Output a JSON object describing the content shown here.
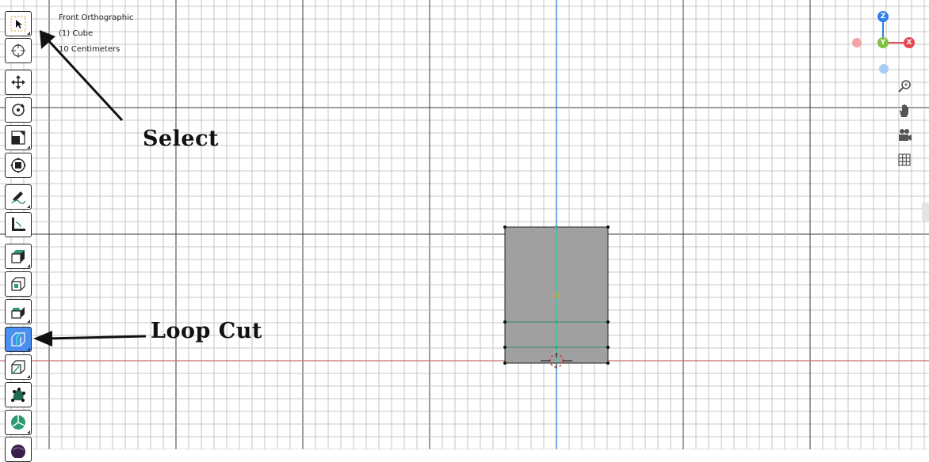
{
  "viewport": {
    "view_name": "Front Orthographic",
    "object_label": "(1) Cube",
    "scale_label": "10 Centimeters"
  },
  "toolbar": {
    "tools": [
      {
        "name": "select-box-tool",
        "icon": "cursor-select-icon",
        "active": false
      },
      {
        "name": "cursor-tool",
        "icon": "crosshair-cursor-icon",
        "active": false
      },
      {
        "name": "move-tool",
        "icon": "move-arrows-icon",
        "active": false
      },
      {
        "name": "rotate-tool",
        "icon": "rotate-icon",
        "active": false
      },
      {
        "name": "scale-tool",
        "icon": "scale-icon",
        "active": false
      },
      {
        "name": "transform-tool",
        "icon": "transform-icon",
        "active": false
      },
      {
        "name": "annotate-tool",
        "icon": "annotate-pencil-icon",
        "active": false
      },
      {
        "name": "measure-tool",
        "icon": "measure-ruler-icon",
        "active": false
      },
      {
        "name": "extrude-tool",
        "icon": "extrude-cube-icon",
        "active": false
      },
      {
        "name": "inset-tool",
        "icon": "inset-faces-icon",
        "active": false
      },
      {
        "name": "bevel-tool",
        "icon": "bevel-icon",
        "active": false
      },
      {
        "name": "loop-cut-tool",
        "icon": "loop-cut-icon",
        "active": true
      },
      {
        "name": "knife-tool",
        "icon": "knife-icon",
        "active": false
      },
      {
        "name": "poly-build-tool",
        "icon": "poly-build-icon",
        "active": false
      },
      {
        "name": "spin-tool",
        "icon": "spin-icon",
        "active": false
      },
      {
        "name": "smooth-tool",
        "icon": "smooth-sphere-icon",
        "active": false
      }
    ]
  },
  "gizmo": {
    "z_label": "Z",
    "y_label": "Y",
    "x_label": "X",
    "colors": {
      "z": "#2f7ee8",
      "y": "#7fc241",
      "x": "#e8454d",
      "neg_x": "#f2a4a8",
      "neg_z": "#a8cdf2"
    }
  },
  "nav_icons": [
    "zoom-icon",
    "hand-pan-icon",
    "camera-icon",
    "grid-ortho-icon"
  ],
  "annotations": {
    "select_label": "Select",
    "loop_cut_label": "Loop Cut"
  },
  "colors": {
    "active_tool": "#4a8ef0",
    "mesh_face": "#a0a0a0",
    "mesh_edge": "#39c6a0",
    "y_axis_line": "#2a6fd6",
    "x_axis_line": "#c77070"
  }
}
